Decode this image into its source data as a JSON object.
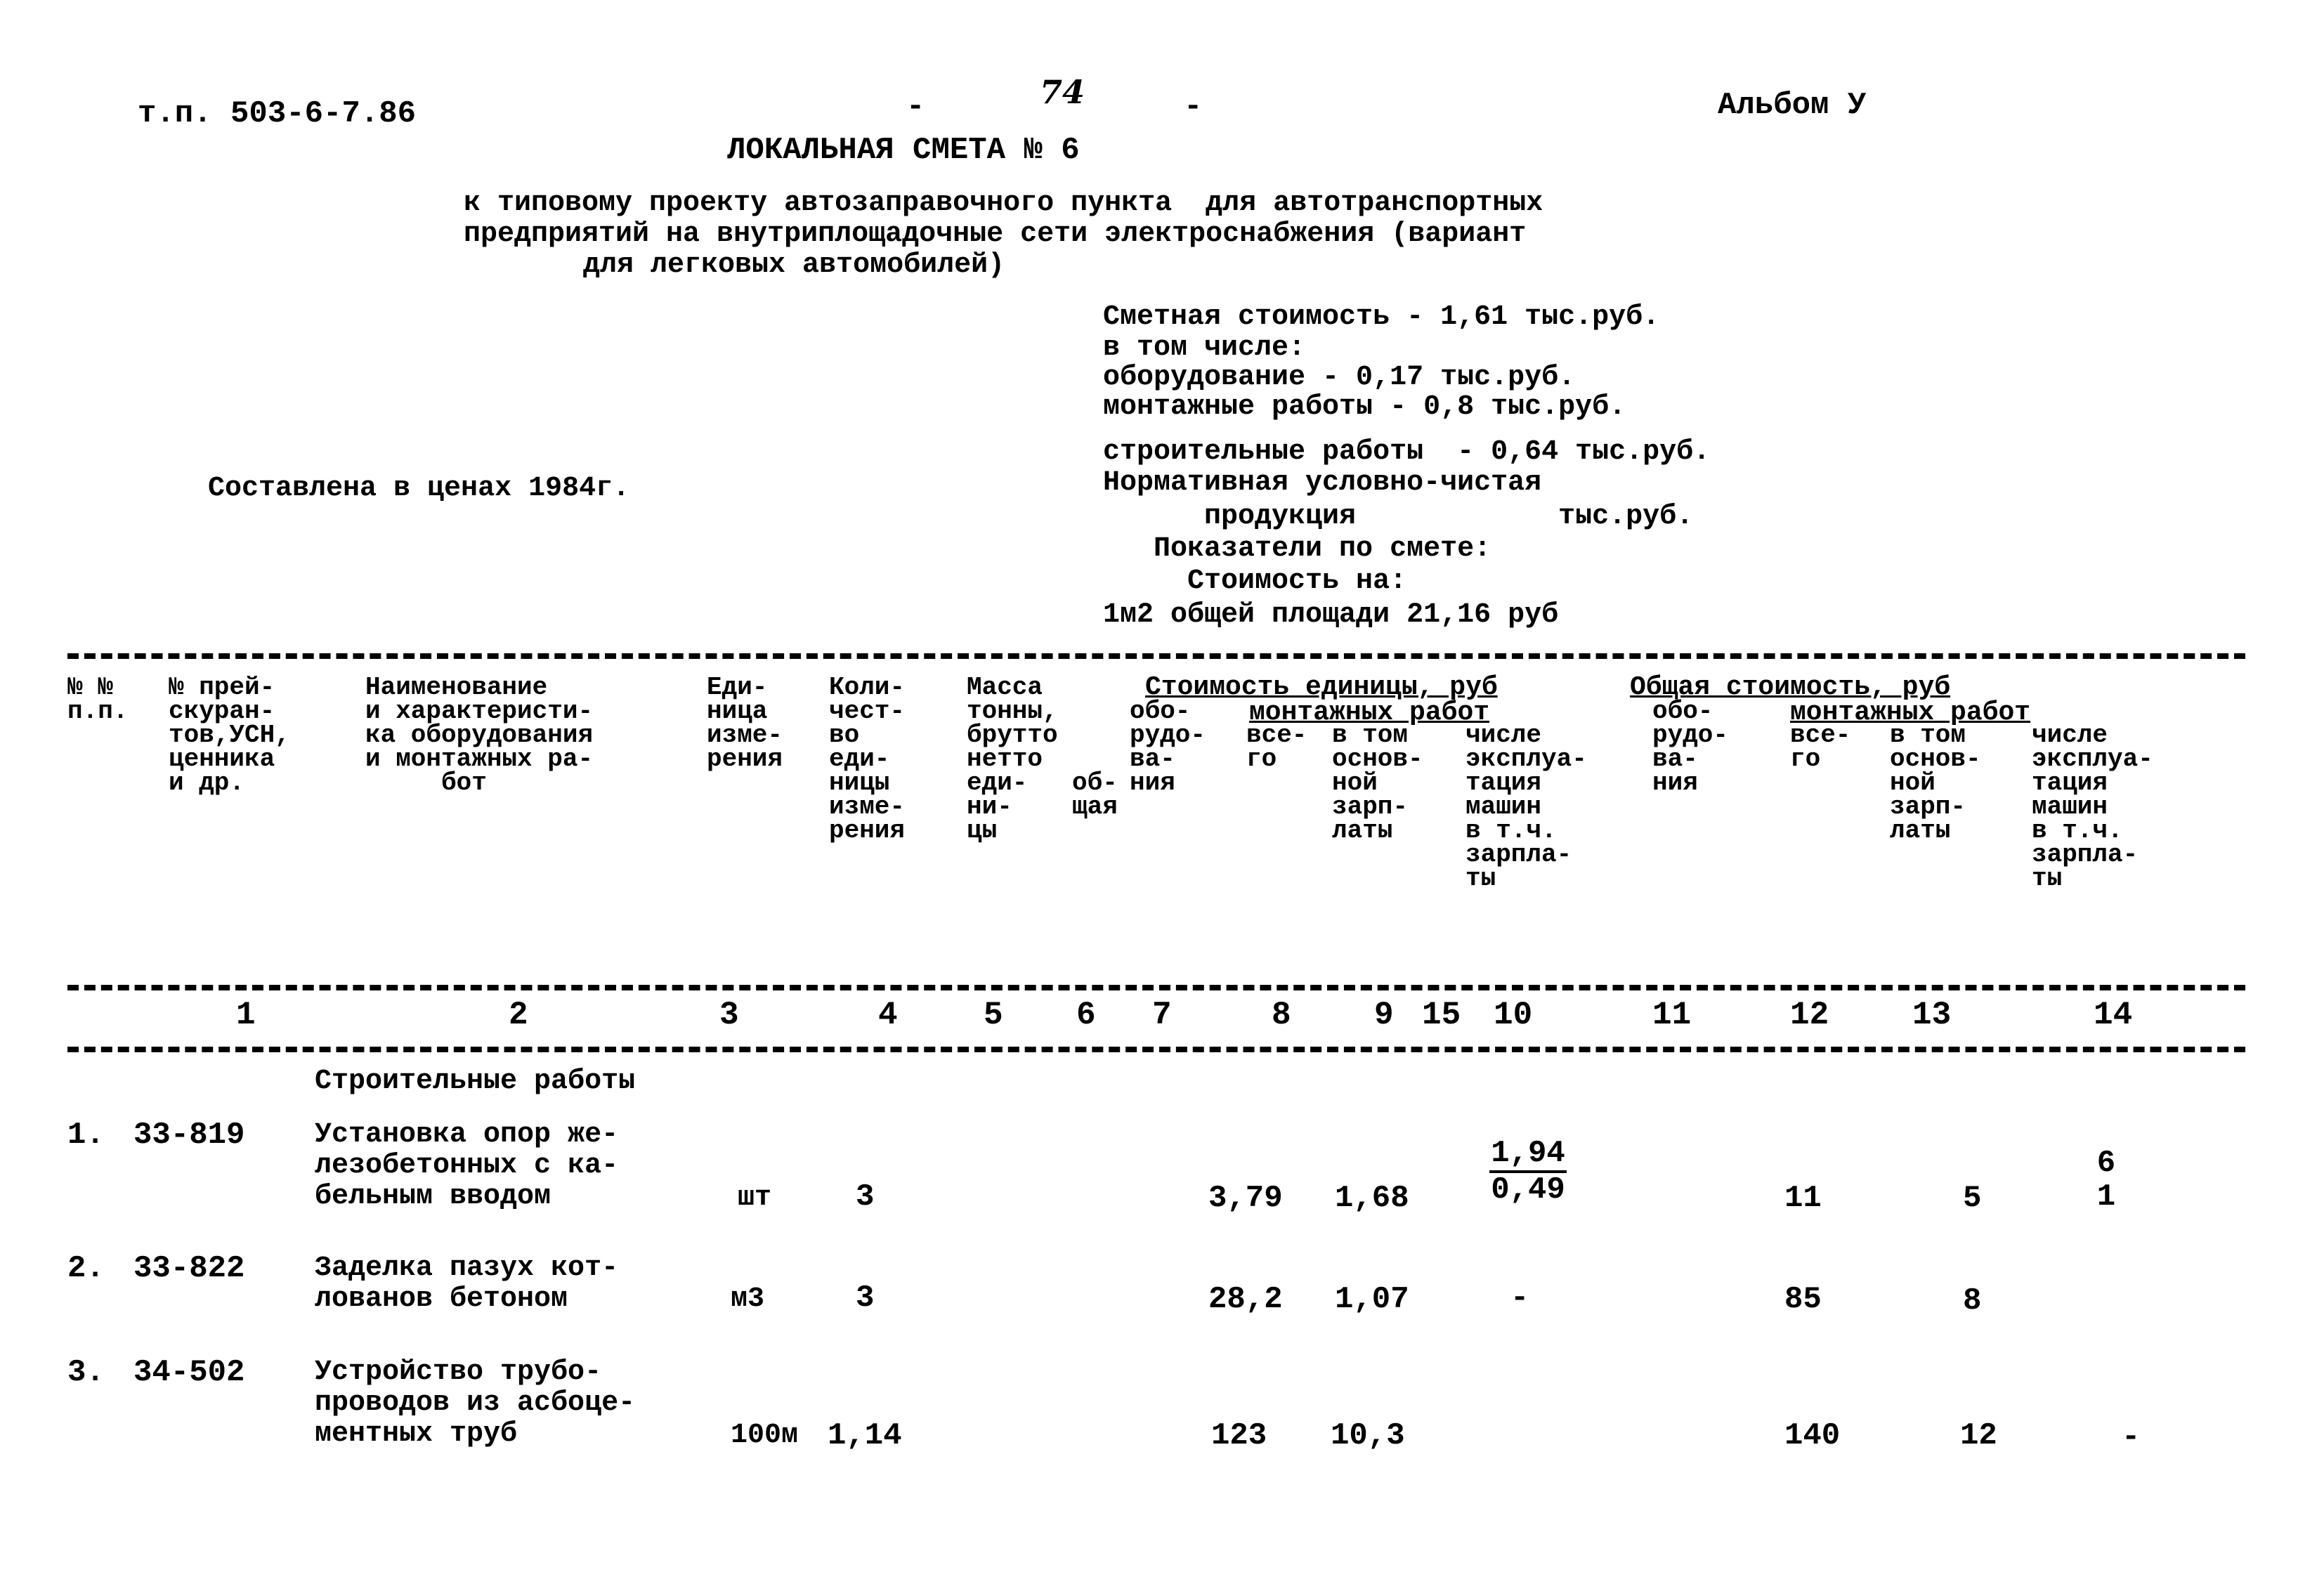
{
  "header": {
    "project_code": "т.п. 503-6-7.86",
    "page_dash_left": "-",
    "page_number": "74",
    "page_dash_right": "-",
    "album": "Альбом У"
  },
  "title": "ЛОКАЛЬНАЯ СМЕТА № 6",
  "subtitle_lines": [
    "к типовому проекту автозаправочного пункта  для автотранспортных",
    "предприятий на внутриплощадочные сети электроснабжения (вариант",
    "для легковых автомобилей)"
  ],
  "prices_note": "Составлена в ценах 1984г.",
  "summary": {
    "lines": [
      "Сметная стоимость - 1,61 тыс.руб.",
      "в том числе:",
      "оборудование - 0,17 тыс.руб.",
      "монтажные работы - 0,8 тыс.руб.",
      "строительные работы  - 0,64 тыс.руб.",
      "Нормативная условно-чистая",
      "      продукция            тыс.руб.",
      "   Показатели по смете:",
      "     Стоимость на:",
      "1м2 общей площади 21,16 руб"
    ]
  },
  "table": {
    "header_cols": [
      "№ №\nп.п.",
      "№ прей-\nскуран-\nтов,УСН,\nценника\nи др.",
      "Наименование\nи характеристи-\nка оборудования\nи монтажных ра-\n     бот",
      "Еди-\nница\nизме-\nрения",
      "Коли-\nчест-\nво\nеди-\nницы\nизме-\nрения",
      "Масса\nтонны,\nбрутто\nнетто\nеди-\nни-\nцы",
      "об-\nщая",
      "обо-\nрудо-\nва-\nния",
      "все-\nго",
      "в том\nоснов-\nной\nзарп-\nлаты",
      "числе\nэксплуа-\nтация\nмашин\nв т.ч.\nзарпла-\nты",
      "обо-\nрудо-\nва-\nния",
      "все-\nго",
      "в том\nоснов-\nной\nзарп-\nлаты",
      "числе\nэксплуа-\nтация\nмашин\nв т.ч.\nзарпла-\nты"
    ],
    "group_unit_cost": "Стоимость единицы, руб",
    "group_unit_install": "монтажных работ",
    "group_total_cost": "Общая стоимость, руб",
    "group_total_install": "монтажных работ",
    "column_numbers": [
      "1",
      "2",
      "3",
      "4",
      "5",
      "6",
      "7",
      "8",
      "9",
      "10",
      "11",
      "12",
      "13",
      "14",
      "15"
    ],
    "section_title": "Строительные работы",
    "rows": [
      {
        "num": "1.",
        "code": "33-819",
        "name": "Установка опор же-\nлезобетонных с ка-\nбельным вводом",
        "unit": "шт",
        "qty": "3",
        "c9": "3,79",
        "c10": "1,68",
        "c11_top": "1,94",
        "c11_bottom": "0,49",
        "c13": "11",
        "c14": "5",
        "c15_top": "6",
        "c15_bottom": "1"
      },
      {
        "num": "2.",
        "code": "33-822",
        "name": "Заделка пазух кот-\nлованов бетоном",
        "unit": "м3",
        "qty": "3",
        "c9": "28,2",
        "c10": "1,07",
        "c11": "-",
        "c13": "85",
        "c14": "8"
      },
      {
        "num": "3.",
        "code": "34-502",
        "name": "Устройство трубо-\nпроводов из асбоце-\nментных труб",
        "unit": "100м",
        "qty": "1,14",
        "c9": "123",
        "c10": "10,3",
        "c13": "140",
        "c14": "12",
        "c15": "-"
      }
    ]
  }
}
